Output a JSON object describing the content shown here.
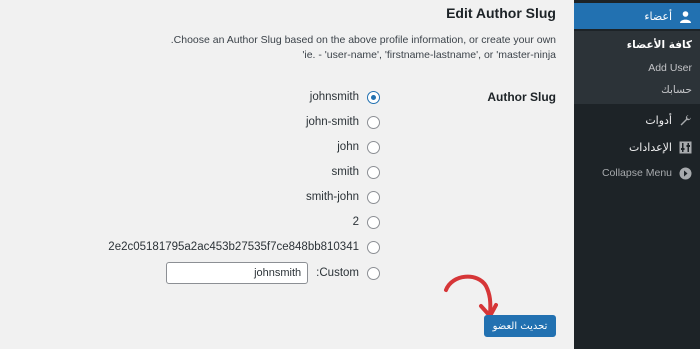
{
  "main": {
    "section_title": "Edit Author Slug",
    "description_line1": ".Choose an Author Slug based on the above profile information, or create your own",
    "description_line2": "'ie. - 'user-name', 'firstname-lastname', or 'master-ninja",
    "field_label": "Author Slug",
    "options": [
      {
        "label": "johnsmith",
        "checked": true
      },
      {
        "label": "john-smith",
        "checked": false
      },
      {
        "label": "john",
        "checked": false
      },
      {
        "label": "smith",
        "checked": false
      },
      {
        "label": "smith-john",
        "checked": false
      },
      {
        "label": "2",
        "checked": false
      },
      {
        "label": "2e2c05181795a2ac453b27535f7ce848bb810341",
        "checked": false
      }
    ],
    "custom_label": ":Custom",
    "custom_value": "johnsmith",
    "update_button": "تحديث العضو"
  },
  "sidebar": {
    "users_label": "أعضاء",
    "submenu": [
      {
        "label": "كافة الأعضاء",
        "current": true
      },
      {
        "label": "Add User",
        "current": false
      },
      {
        "label": "حسابك",
        "current": false
      }
    ],
    "tools_label": "أدوات",
    "settings_label": "الإعدادات",
    "collapse_label": "Collapse Menu"
  },
  "colors": {
    "accent": "#2271b1",
    "sidebar_bg": "#1d2327",
    "submenu_bg": "#2c3338",
    "arrow": "#d63638"
  }
}
